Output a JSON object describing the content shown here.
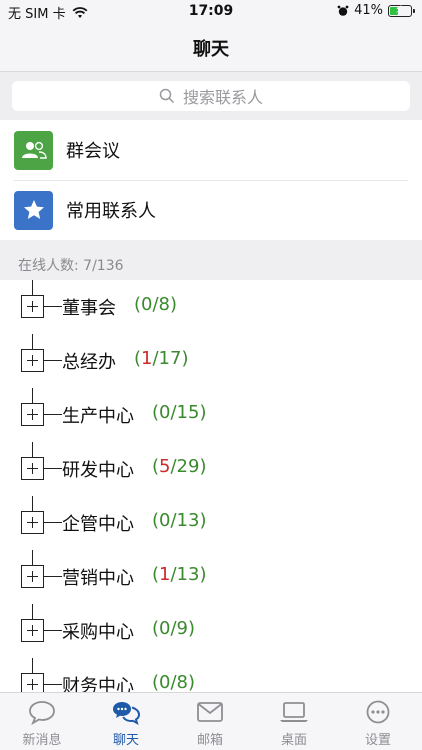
{
  "status_bar": {
    "carrier": "无 SIM 卡",
    "time": "17:09",
    "battery_percent": "41%",
    "battery_level": 0.41
  },
  "nav": {
    "title": "聊天"
  },
  "search": {
    "placeholder": "搜索联系人"
  },
  "quick_actions": [
    {
      "label": "群会议",
      "icon": "group-icon",
      "color": "#4ca444"
    },
    {
      "label": "常用联系人",
      "icon": "star-icon",
      "color": "#3b73c8"
    }
  ],
  "online": {
    "text": "在线人数: 7/136"
  },
  "departments": [
    {
      "name": "董事会",
      "open": "(",
      "online": "0",
      "sep": "/8)",
      "online_color": "green"
    },
    {
      "name": "总经办",
      "open": "(",
      "online": "1",
      "sep": "/17)",
      "online_color": "red"
    },
    {
      "name": "生产中心",
      "open": "(",
      "online": "0",
      "sep": "/15)",
      "online_color": "green"
    },
    {
      "name": "研发中心",
      "open": "(",
      "online": "5",
      "sep": "/29)",
      "online_color": "red"
    },
    {
      "name": "企管中心",
      "open": "(",
      "online": "0",
      "sep": "/13)",
      "online_color": "green"
    },
    {
      "name": "营销中心",
      "open": "(",
      "online": "1",
      "sep": "/13)",
      "online_color": "red"
    },
    {
      "name": "采购中心",
      "open": "(",
      "online": "0",
      "sep": "/9)",
      "online_color": "green"
    },
    {
      "name": "财务中心",
      "open": "(",
      "online": "0",
      "sep": "/8)",
      "online_color": "green"
    }
  ],
  "tabs": [
    {
      "label": "新消息",
      "icon": "chat-bubble-icon",
      "active": false
    },
    {
      "label": "聊天",
      "icon": "chat-bubbles-icon",
      "active": true
    },
    {
      "label": "邮箱",
      "icon": "mail-icon",
      "active": false
    },
    {
      "label": "桌面",
      "icon": "laptop-icon",
      "active": false
    },
    {
      "label": "设置",
      "icon": "more-icon",
      "active": false
    }
  ],
  "colors": {
    "accent": "#1e5aa8",
    "online_green": "#3a8a2e",
    "online_red": "#cc2b2b"
  }
}
